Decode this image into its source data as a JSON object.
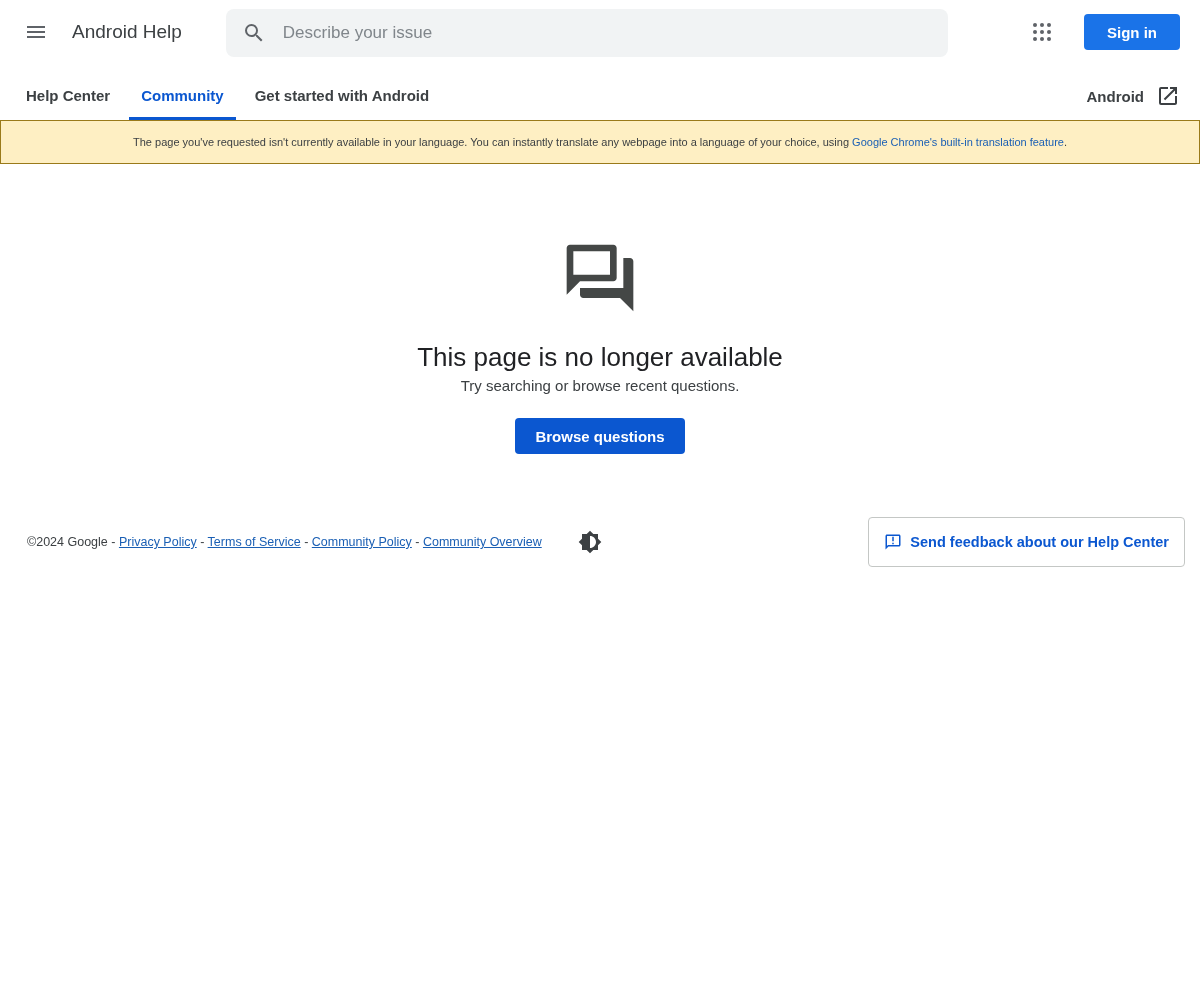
{
  "header": {
    "title": "Android Help",
    "search": {
      "placeholder": "Describe your issue"
    },
    "sign_in": "Sign in"
  },
  "tabs": [
    {
      "label": "Help Center",
      "selected": false
    },
    {
      "label": "Community",
      "selected": true
    },
    {
      "label": "Get started with Android",
      "selected": false
    }
  ],
  "external_link": "Android",
  "notice": {
    "text": "The page you've requested isn't currently available in your language. You can instantly translate any webpage into a language of your choice, using ",
    "link": "Google Chrome's built-in translation feature",
    "end": "."
  },
  "message": {
    "title": "This page is no longer available",
    "subtitle": "Try searching or browse recent questions.",
    "button": "Browse questions"
  },
  "footer": {
    "parts": [
      {
        "kind": "text",
        "text": "©2024 Google - "
      },
      {
        "kind": "link",
        "text": "Privacy Policy"
      },
      {
        "kind": "text",
        "text": " - "
      },
      {
        "kind": "link",
        "text": "Terms of Service"
      },
      {
        "kind": "text",
        "text": " - "
      },
      {
        "kind": "link",
        "text": "Community Policy"
      },
      {
        "kind": "text",
        "text": " - "
      },
      {
        "kind": "link",
        "text": "Community Overview"
      }
    ],
    "feedback": "Send feedback about our Help Center"
  }
}
